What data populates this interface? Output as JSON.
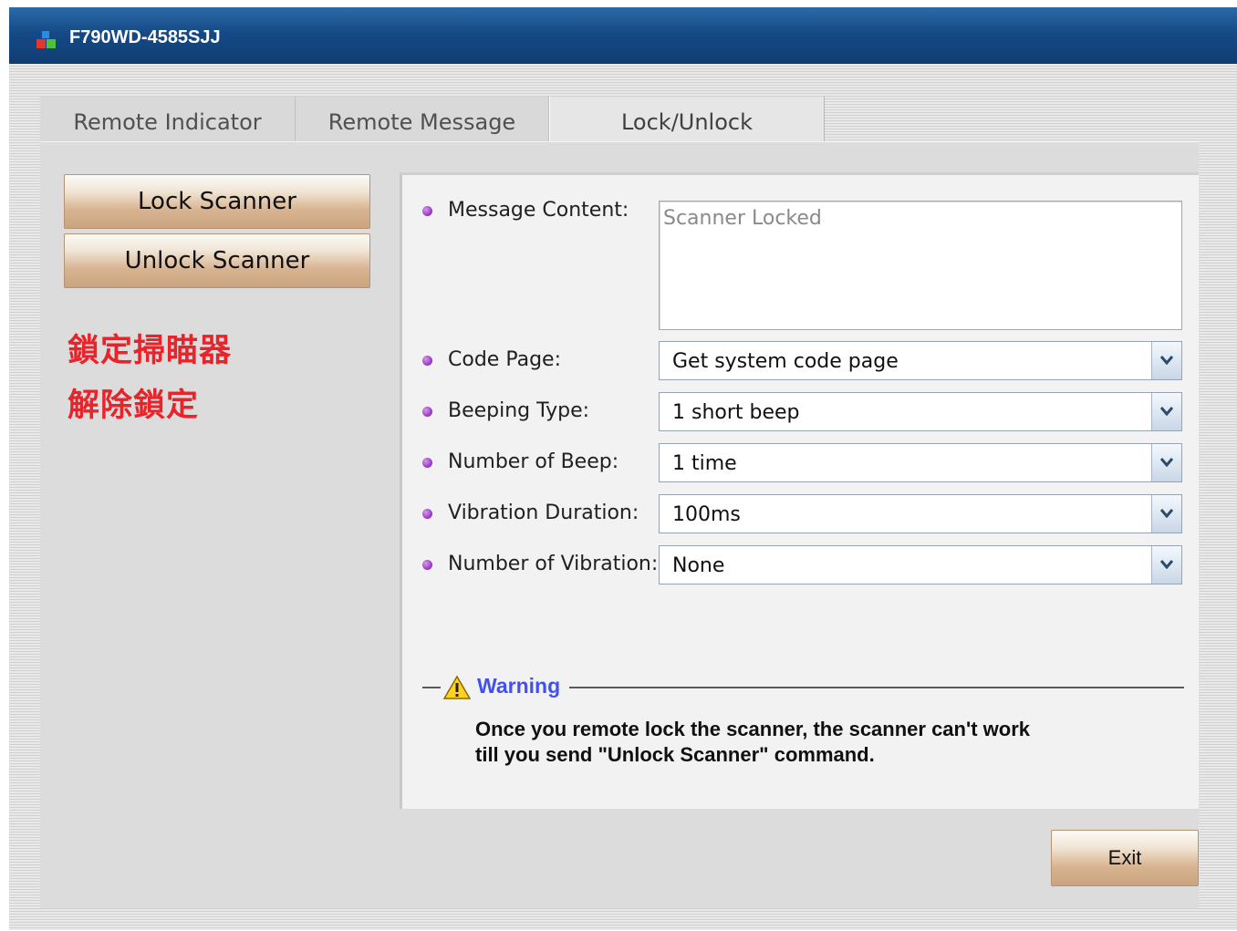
{
  "window": {
    "title": "F790WD-4585SJJ"
  },
  "tabs": [
    {
      "label": "Remote Indicator"
    },
    {
      "label": "Remote Message"
    },
    {
      "label": "Lock/Unlock"
    }
  ],
  "active_tab": "Lock/Unlock",
  "actions": {
    "lock_label": "Lock Scanner",
    "unlock_label": "Unlock Scanner"
  },
  "annotations": {
    "lock_cn": "鎖定掃瞄器",
    "unlock_cn": "解除鎖定",
    "color": "#e8242a"
  },
  "form": {
    "message_content": {
      "label": "Message Content:",
      "value": "Scanner Locked"
    },
    "code_page": {
      "label": "Code Page:",
      "value": "Get system code page"
    },
    "beeping_type": {
      "label": "Beeping Type:",
      "value": "1 short beep"
    },
    "number_of_beep": {
      "label": "Number of Beep:",
      "value": "1 time"
    },
    "vibration_duration": {
      "label": "Vibration Duration:",
      "value": "100ms"
    },
    "number_of_vibration": {
      "label": "Number of Vibration:",
      "value": "None"
    }
  },
  "warning": {
    "title": "Warning",
    "text": "Once you remote lock the scanner, the scanner can't work\ntill you send \"Unlock Scanner\" command."
  },
  "footer": {
    "exit_label": "Exit"
  },
  "icons": {
    "app": "app-blocks-icon",
    "bullet": "purple-bullet-icon",
    "dropdown": "chevron-down-icon",
    "warning": "warning-triangle-icon"
  }
}
